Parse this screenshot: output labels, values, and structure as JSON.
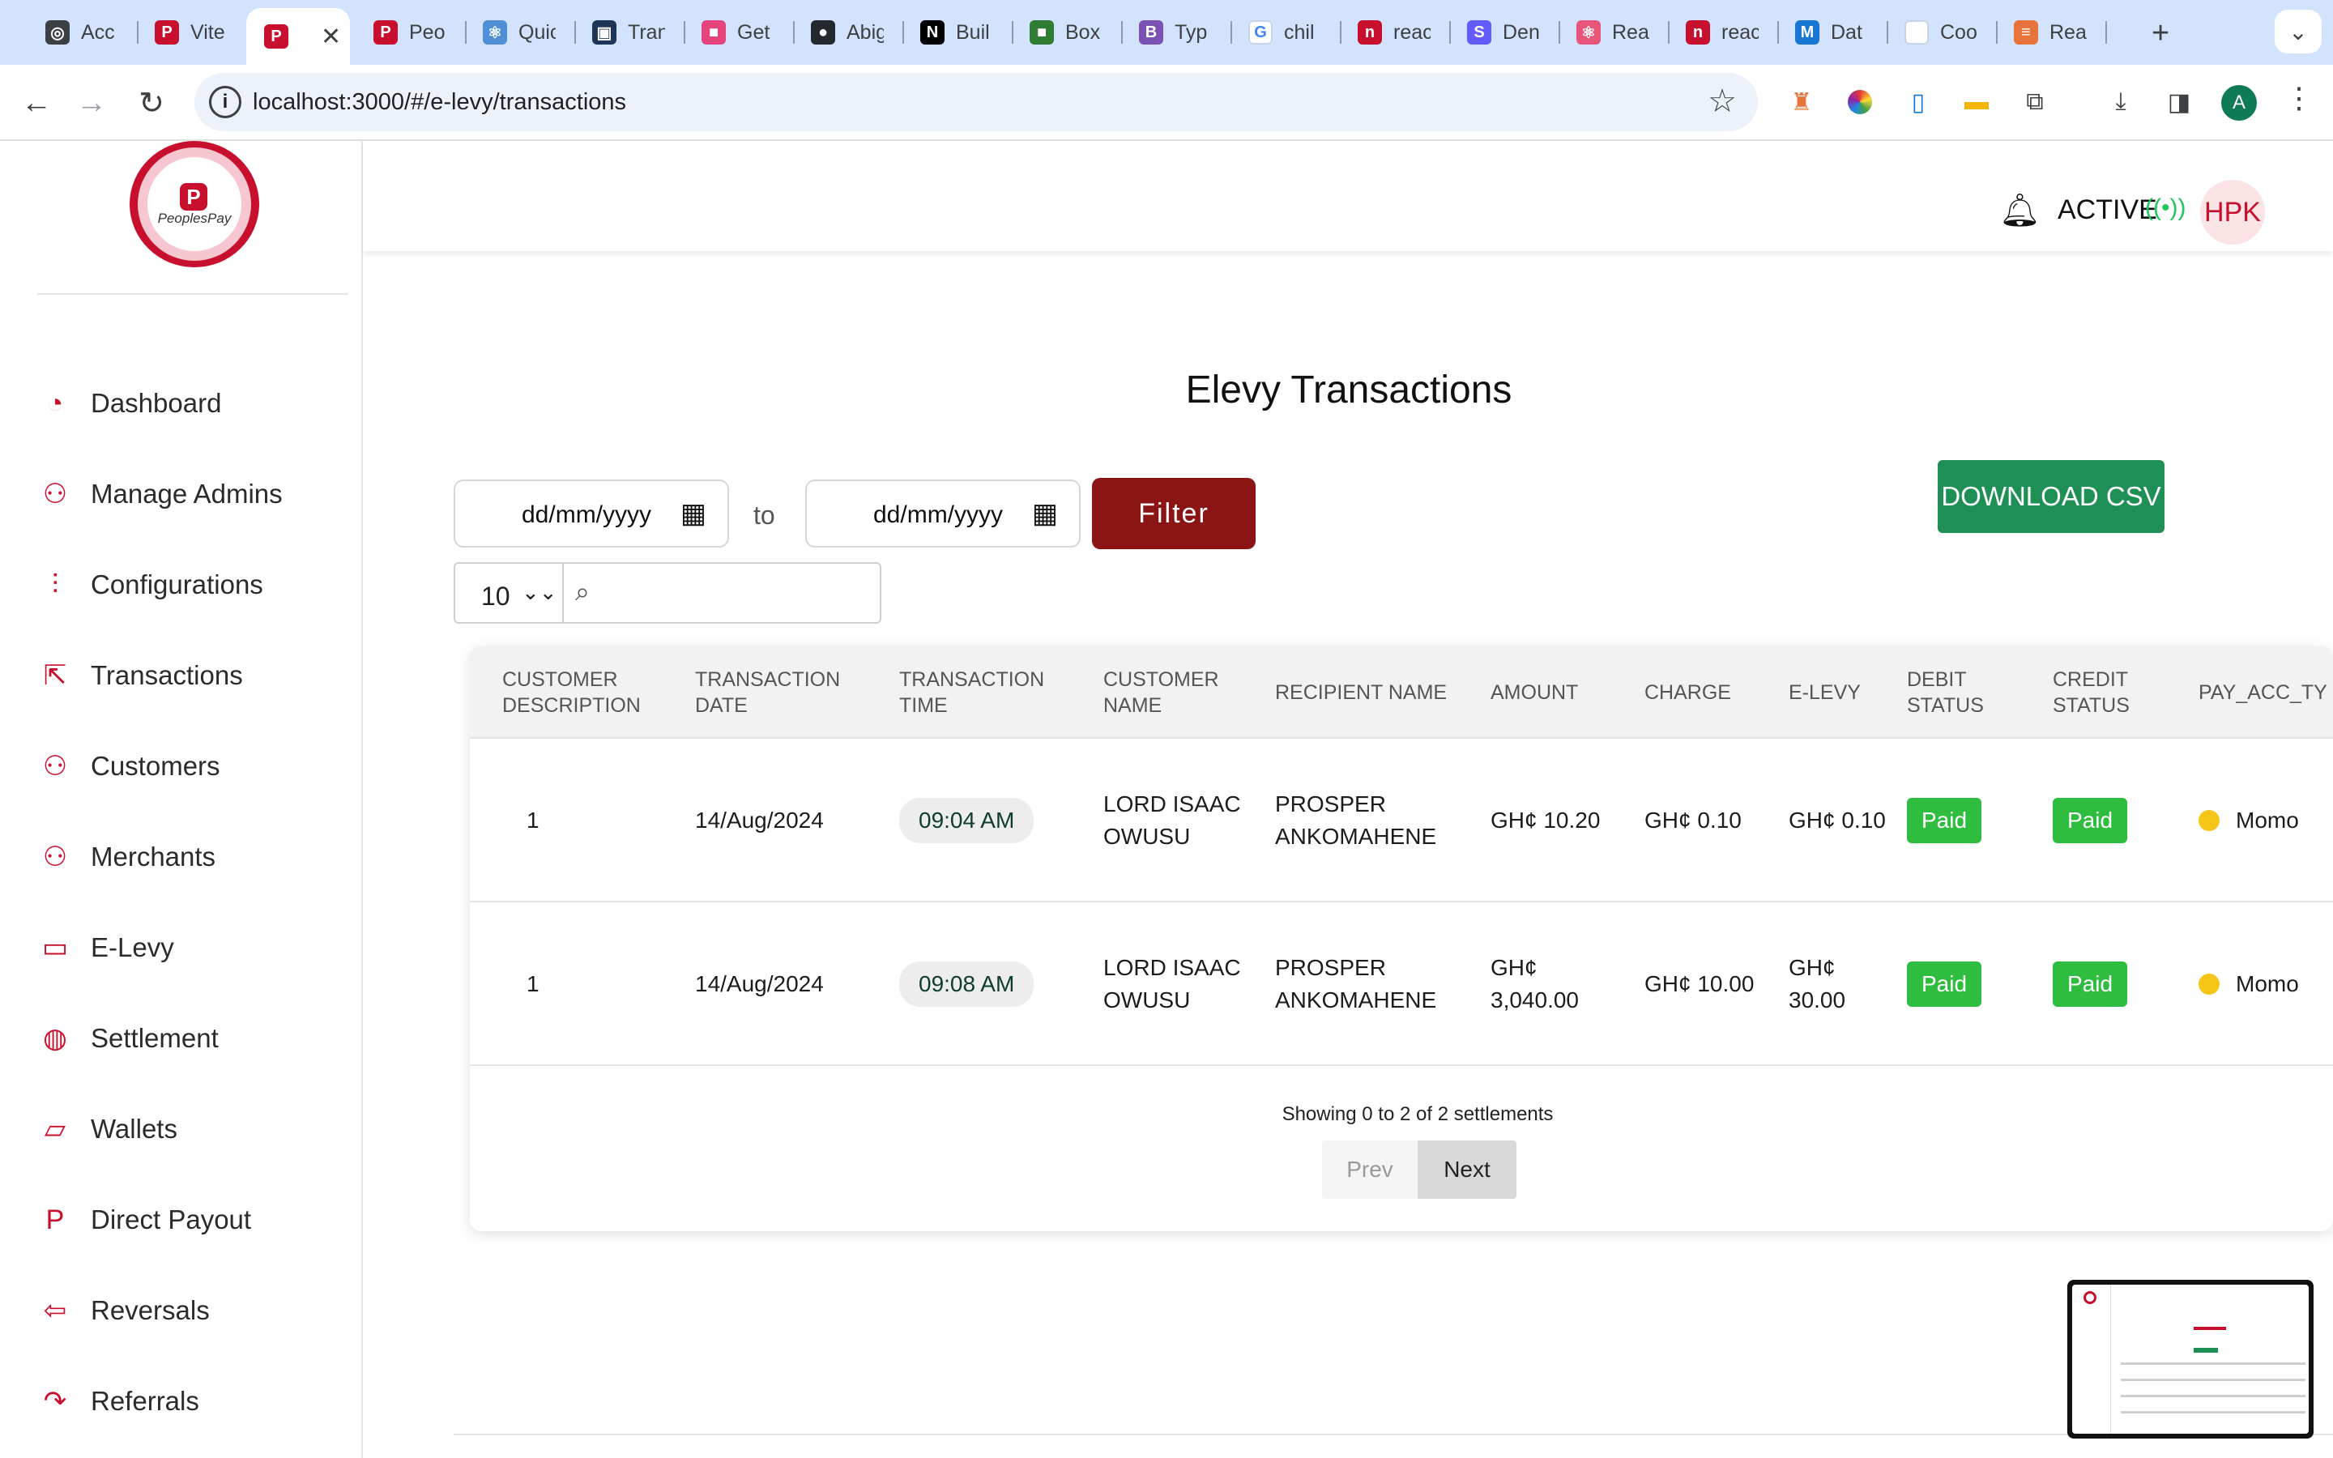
{
  "browser": {
    "tabs": [
      {
        "title": "Acc",
        "icon": "openai-icon",
        "color": "#3c4043",
        "glyph": "◎"
      },
      {
        "title": "Vite",
        "icon": "peoplespay-icon",
        "color": "#c8102e",
        "glyph": "P"
      },
      {
        "title": "",
        "icon": "peoplespay-icon",
        "color": "#c8102e",
        "glyph": "P",
        "active": true
      },
      {
        "title": "Peo",
        "icon": "peoplespay-icon",
        "color": "#c8102e",
        "glyph": "P"
      },
      {
        "title": "Quic",
        "icon": "react-icon",
        "color": "#4f8fd6",
        "glyph": "⚛"
      },
      {
        "title": "Tran",
        "icon": "codesandbox-icon",
        "color": "#1d3557",
        "glyph": "▣"
      },
      {
        "title": "Get",
        "icon": "app-icon",
        "color": "#e5457a",
        "glyph": "■"
      },
      {
        "title": "Abig",
        "icon": "github-icon",
        "color": "#24292f",
        "glyph": "●"
      },
      {
        "title": "Buil",
        "icon": "nextjs-icon",
        "color": "#000000",
        "glyph": "N"
      },
      {
        "title": "Box",
        "icon": "box-icon",
        "color": "#2e7d32",
        "glyph": "■"
      },
      {
        "title": "Typ",
        "icon": "bootstrap-icon",
        "color": "#7952b3",
        "glyph": "B"
      },
      {
        "title": "chil",
        "icon": "google-icon",
        "color": "#ffffff",
        "glyph": "G"
      },
      {
        "title": "reac",
        "icon": "npm-icon",
        "color": "#c8102e",
        "glyph": "n"
      },
      {
        "title": "Den",
        "icon": "stripe-icon",
        "color": "#635bff",
        "glyph": "S"
      },
      {
        "title": "Rea",
        "icon": "react-icon",
        "color": "#e8577a",
        "glyph": "⚛"
      },
      {
        "title": "reac",
        "icon": "npm-icon",
        "color": "#c8102e",
        "glyph": "n"
      },
      {
        "title": "Dat",
        "icon": "mui-icon",
        "color": "#1976d2",
        "glyph": "M"
      },
      {
        "title": "Coo",
        "icon": "blank-page-icon",
        "color": "#ffffff",
        "glyph": ""
      },
      {
        "title": "Rea",
        "icon": "stack-icon",
        "color": "#e8743b",
        "glyph": "≡"
      }
    ],
    "url": "localhost:3000/#/e-levy/transactions",
    "profile_initial": "A"
  },
  "brand": {
    "name": "PeoplesPay",
    "primary": "#c8102e",
    "filter_color": "#8b1515",
    "csv_color": "#1e8f55",
    "paid_color": "#2ebd3e"
  },
  "sidebar": {
    "items": [
      {
        "label": "Dashboard",
        "icon": "dashboard-gauge-icon",
        "glyph": "◔"
      },
      {
        "label": "Manage Admins",
        "icon": "user-check-icon",
        "glyph": "⚇"
      },
      {
        "label": "Configurations",
        "icon": "sliders-icon",
        "glyph": "⫶"
      },
      {
        "label": "Transactions",
        "icon": "transactions-icon",
        "glyph": "⇱"
      },
      {
        "label": "Customers",
        "icon": "users-icon",
        "glyph": "⚇"
      },
      {
        "label": "Merchants",
        "icon": "users-icon",
        "glyph": "⚇"
      },
      {
        "label": "E-Levy",
        "icon": "money-icon",
        "glyph": "▭"
      },
      {
        "label": "Settlement",
        "icon": "globe-icon",
        "glyph": "◍"
      },
      {
        "label": "Wallets",
        "icon": "wallet-icon",
        "glyph": "▱"
      },
      {
        "label": "Direct Payout",
        "icon": "paypal-icon",
        "glyph": "P"
      },
      {
        "label": "Reversals",
        "icon": "sign-in-icon",
        "glyph": "⇦"
      },
      {
        "label": "Referrals",
        "icon": "share-icon",
        "glyph": "↷"
      }
    ]
  },
  "topbar": {
    "status": "ACTIVE",
    "user_initials": "HPK"
  },
  "main": {
    "title": "Elevy Transactions",
    "from_date_placeholder": "dd/mm/yyyy",
    "to_label": "to",
    "to_date_placeholder": "dd/mm/yyyy",
    "filter_label": "Filter",
    "download_label": "DOWNLOAD CSV",
    "page_size": "10",
    "search_value": ""
  },
  "table": {
    "columns": [
      "CUSTOMER DESCRIPTION",
      "TRANSACTION DATE",
      "TRANSACTION TIME",
      "CUSTOMER NAME",
      "RECIPIENT NAME",
      "AMOUNT",
      "CHARGE",
      "E-LEVY",
      "DEBIT STATUS",
      "CREDIT STATUS",
      "PAY_ACC_TY"
    ],
    "rows": [
      {
        "description": "1",
        "date": "14/Aug/2024",
        "time": "09:04 AM",
        "customer": "LORD ISAAC OWUSU",
        "recipient": "PROSPER ANKOMAHENE",
        "amount": "GH¢ 10.20",
        "charge": "GH¢ 0.10",
        "elevy": "GH¢ 0.10",
        "debit": "Paid",
        "credit": "Paid",
        "pay_acc": "Momo"
      },
      {
        "description": "1",
        "date": "14/Aug/2024",
        "time": "09:08 AM",
        "customer": "LORD ISAAC OWUSU",
        "recipient": "PROSPER ANKOMAHENE",
        "amount": "GH¢ 3,040.00",
        "charge": "GH¢ 10.00",
        "elevy": "GH¢ 30.00",
        "debit": "Paid",
        "credit": "Paid",
        "pay_acc": "Momo"
      }
    ],
    "showing": "Showing 0 to 2 of 2 settlements",
    "prev_label": "Prev",
    "next_label": "Next"
  }
}
